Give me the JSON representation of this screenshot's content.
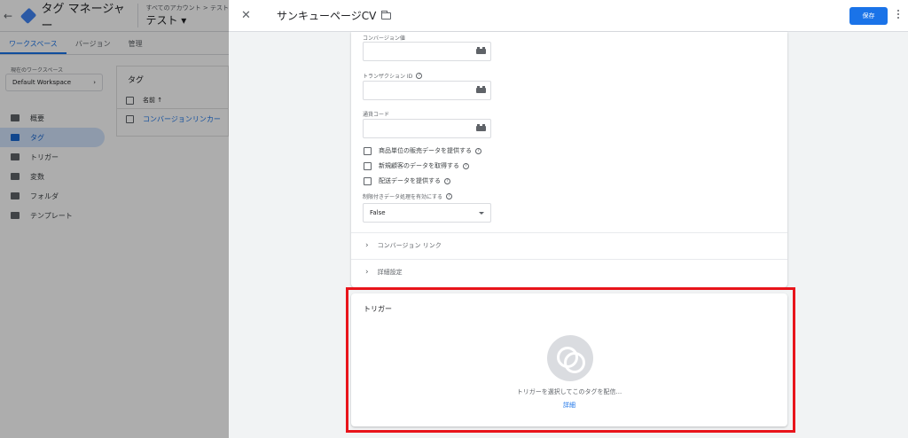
{
  "app": {
    "back_icon": "arrow-left-icon",
    "title": "タグ マネージャー",
    "account_breadcrumb": "すべてのアカウント > テスト",
    "container_name": "テスト ▾"
  },
  "top_tabs": [
    {
      "label": "ワークスペース",
      "active": true
    },
    {
      "label": "バージョン",
      "active": false
    },
    {
      "label": "管理",
      "active": false
    }
  ],
  "workspace": {
    "label": "現在のワークスペース",
    "value": "Default Workspace",
    "chevron": "›"
  },
  "nav": [
    {
      "label": "概要",
      "icon": "overview-icon",
      "active": false
    },
    {
      "label": "タグ",
      "icon": "tag-icon",
      "active": true
    },
    {
      "label": "トリガー",
      "icon": "trigger-icon",
      "active": false
    },
    {
      "label": "変数",
      "icon": "variable-icon",
      "active": false
    },
    {
      "label": "フォルダ",
      "icon": "folder-icon",
      "active": false
    },
    {
      "label": "テンプレート",
      "icon": "template-icon",
      "active": false
    }
  ],
  "tags_panel": {
    "title": "タグ",
    "column_name": "名前 ↑",
    "rows": [
      "コンバージョンリンカー"
    ]
  },
  "editor": {
    "close": "✕",
    "title": "サンキューページCV",
    "save_label": "保存",
    "accent_color": "#1a73e8"
  },
  "config": {
    "conversion_value_label": "コンバージョン値",
    "transaction_id_label": "トランザクション ID",
    "currency_code_label": "通貨コード",
    "checkboxes": [
      "商品単位の販売データを提供する",
      "新規顧客のデータを取得する",
      "配送データを提供する"
    ],
    "restricted_data_label": "制限付きデータ処理を有効にする",
    "restricted_data_value": "False",
    "sections": [
      "コンバージョン リンク",
      "詳細設定"
    ]
  },
  "trigger": {
    "title": "トリガー",
    "hint": "トリガーを選択してこのタグを配信...",
    "learn_more": "詳細",
    "highlight_color": "#e8141b"
  }
}
